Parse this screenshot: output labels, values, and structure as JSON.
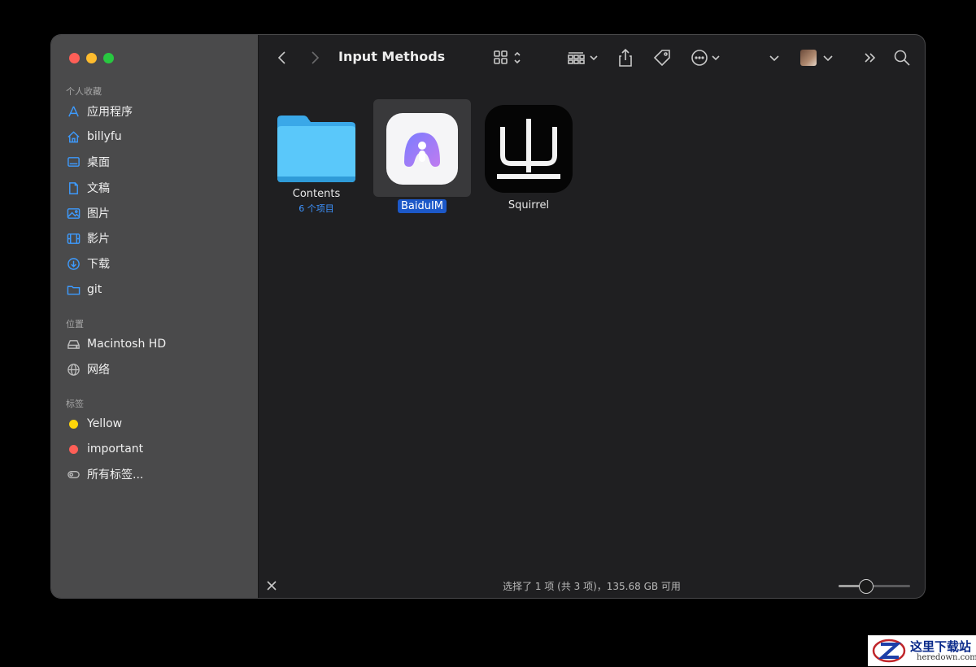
{
  "window": {
    "title": "Input Methods"
  },
  "sidebar": {
    "favorites_label": "个人收藏",
    "favorites": [
      {
        "label": "应用程序",
        "icon": "applications-icon"
      },
      {
        "label": "billyfu",
        "icon": "home-icon"
      },
      {
        "label": "桌面",
        "icon": "desktop-icon"
      },
      {
        "label": "文稿",
        "icon": "documents-icon"
      },
      {
        "label": "图片",
        "icon": "pictures-icon"
      },
      {
        "label": "影片",
        "icon": "movies-icon"
      },
      {
        "label": "下载",
        "icon": "downloads-icon"
      },
      {
        "label": "git",
        "icon": "folder-icon"
      }
    ],
    "locations_label": "位置",
    "locations": [
      {
        "label": "Macintosh HD",
        "icon": "hard-drive-icon"
      },
      {
        "label": "网络",
        "icon": "network-icon"
      }
    ],
    "tags_label": "标签",
    "tags": [
      {
        "label": "Yellow",
        "color": "#ffd60a"
      },
      {
        "label": "important",
        "color": "#ff5f57"
      },
      {
        "label": "所有标签...",
        "icon": "all-tags-icon"
      }
    ]
  },
  "files": [
    {
      "name": "Contents",
      "subtitle": "6 个项目",
      "icon": "folder-icon"
    },
    {
      "name": "BaiduIM",
      "selected": true,
      "icon": "baidu-im-app-icon"
    },
    {
      "name": "Squirrel",
      "icon": "squirrel-app-icon",
      "glyph": "ㄓ"
    }
  ],
  "status": {
    "text": "选择了 1 项 (共 3 项)，135.68 GB 可用",
    "icon_size_fraction": 0.38
  },
  "watermark": {
    "text": "这里下载站",
    "sub": "heredown.com"
  },
  "colors": {
    "accent": "#3d9bff",
    "selection": "#1c58c8"
  }
}
